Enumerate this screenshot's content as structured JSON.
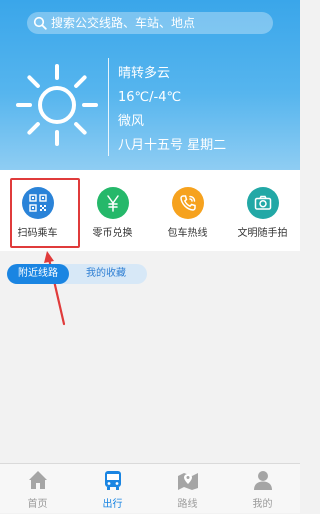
{
  "search": {
    "placeholder": "搜索公交线路、车站、地点"
  },
  "weather": {
    "condition": "晴转多云",
    "temperature": "16℃/-4℃",
    "wind": "微风",
    "date": "八月十五号 星期二",
    "icon": "sun-icon"
  },
  "quick_actions": [
    {
      "label": "扫码乘车",
      "icon": "qr-code-icon",
      "color": "#2a83d8",
      "highlighted": true
    },
    {
      "label": "零币兑换",
      "icon": "yuan-icon",
      "color": "#25b86a"
    },
    {
      "label": "包车热线",
      "icon": "phone-icon",
      "color": "#f6a21e"
    },
    {
      "label": "文明随手拍",
      "icon": "camera-icon",
      "color": "#22a8a6"
    }
  ],
  "tabs": [
    {
      "label": "附近线路",
      "active": true
    },
    {
      "label": "我的收藏",
      "active": false
    }
  ],
  "tabbar": [
    {
      "label": "首页",
      "icon": "home-icon",
      "active": false
    },
    {
      "label": "出行",
      "icon": "bus-icon",
      "active": true
    },
    {
      "label": "路线",
      "icon": "map-icon",
      "active": false
    },
    {
      "label": "我的",
      "icon": "user-icon",
      "active": false
    }
  ],
  "colors": {
    "header_top": "#3aa6ea",
    "accent": "#1a85e2",
    "highlight": "#e03b3b",
    "inactive_tab": "#9a9a9a"
  }
}
